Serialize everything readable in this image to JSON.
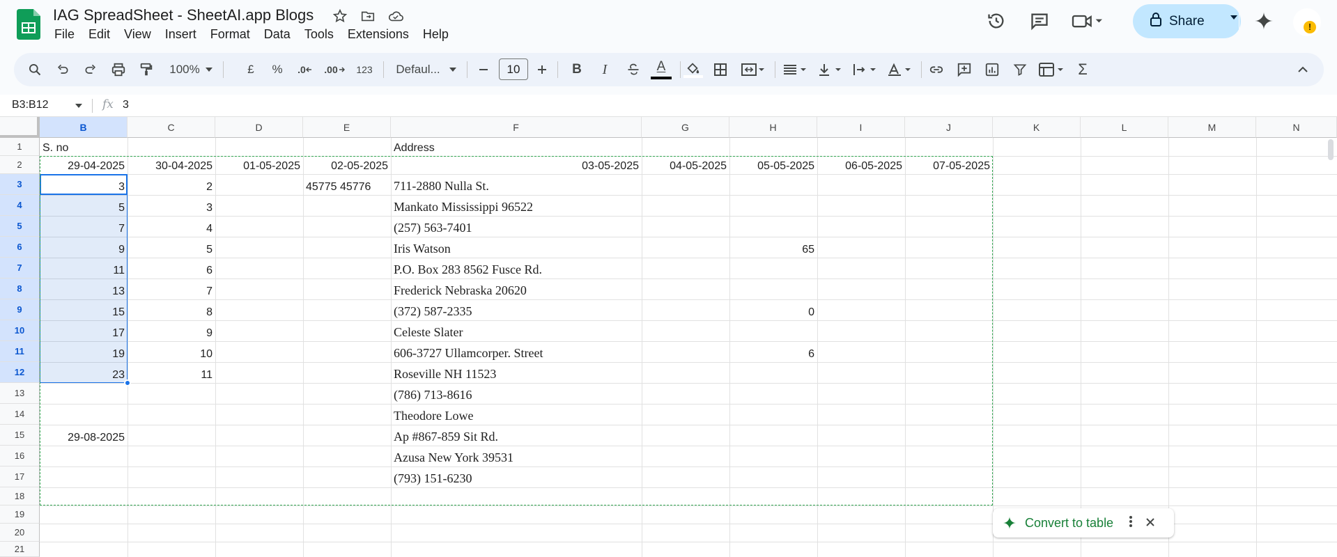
{
  "app": {
    "title": "IAG SpreadSheet - SheetAI.app Blogs",
    "menu": [
      "File",
      "Edit",
      "View",
      "Insert",
      "Format",
      "Data",
      "Tools",
      "Extensions",
      "Help"
    ],
    "share_label": "Share",
    "accent": "#c2e7ff"
  },
  "toolbar": {
    "zoom": "100%",
    "currency": "£",
    "percent": "%",
    "dec_decrease": ".0",
    "dec_increase": ".00",
    "number_format": "123",
    "font": "Defaul...",
    "font_size": "10",
    "bold": "B",
    "italic": "I",
    "text_color_glyph": "A",
    "sigma": "Σ"
  },
  "formula_bar": {
    "name_box": "B3:B12",
    "fx": "fx",
    "value": "3"
  },
  "columns": [
    "B",
    "C",
    "D",
    "E",
    "F",
    "G",
    "H",
    "I",
    "J",
    "K",
    "L",
    "M",
    "N"
  ],
  "rows": [
    "1",
    "2",
    "3",
    "4",
    "5",
    "6",
    "7",
    "8",
    "9",
    "10",
    "11",
    "12",
    "13",
    "14",
    "15",
    "16",
    "17",
    "18",
    "19",
    "20",
    "21"
  ],
  "cells": {
    "b1": "S. no",
    "f1": "Address",
    "b2": "29-04-2025",
    "c2": "30-04-2025",
    "d2": "01-05-2025",
    "e2": "02-05-2025",
    "f2": "03-05-2025",
    "g2": "04-05-2025",
    "h2": "05-05-2025",
    "i2": "06-05-2025",
    "j2": "07-05-2025",
    "b": [
      "3",
      "5",
      "7",
      "9",
      "11",
      "13",
      "15",
      "17",
      "19",
      "23"
    ],
    "c": [
      "2",
      "3",
      "4",
      "5",
      "6",
      "7",
      "8",
      "9",
      "10",
      "11"
    ],
    "e3": "45775 45776",
    "f": [
      "711-2880 Nulla St.",
      "Mankato Mississippi 96522",
      "(257) 563-7401",
      "Iris Watson",
      "P.O. Box 283 8562 Fusce Rd.",
      "Frederick Nebraska 20620",
      "(372) 587-2335",
      "Celeste Slater",
      "606-3727 Ullamcorper. Street",
      "Roseville NH 11523",
      "(786) 713-8616",
      "Theodore Lowe",
      "Ap #867-859 Sit Rd.",
      "Azusa New York 39531",
      "(793) 151-6230"
    ],
    "h6": "65",
    "h9": "0",
    "h11": "6",
    "b15": "29-08-2025"
  },
  "convert": {
    "label": "Convert to table"
  }
}
